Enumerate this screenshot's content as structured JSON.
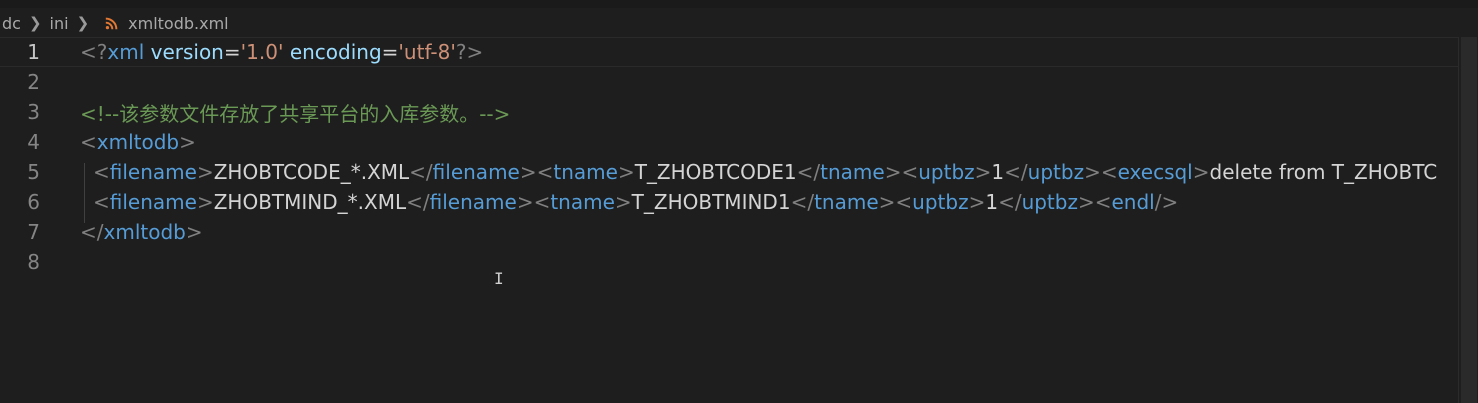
{
  "breadcrumb": {
    "segments": [
      "dc",
      "ini"
    ],
    "file": "xmltodb.xml",
    "file_icon": "rss-feed-icon"
  },
  "lines": {
    "numbers": [
      "1",
      "2",
      "3",
      "4",
      "5",
      "6",
      "7",
      "8"
    ],
    "l1": {
      "open": "<?",
      "name": "xml",
      "attr1": "version",
      "eq1": "=",
      "val1": "'1.0'",
      "attr2": "encoding",
      "eq2": "=",
      "val2": "'utf-8'",
      "close": "?>"
    },
    "l3": {
      "comment": "<!--该参数文件存放了共享平台的入库参数。-->"
    },
    "l4": {
      "lt": "<",
      "tag": "xmltodb",
      "gt": ">"
    },
    "l5": {
      "lt1": "<",
      "t1": "filename",
      "gt1": ">",
      "v1": "ZHOBTCODE_*.XML",
      "ce1": "</",
      "c1": "filename",
      "cg1": ">",
      "lt2": "<",
      "t2": "tname",
      "gt2": ">",
      "v2": "T_ZHOBTCODE1",
      "ce2": "</",
      "c2": "tname",
      "cg2": ">",
      "lt3": "<",
      "t3": "uptbz",
      "gt3": ">",
      "v3": "1",
      "ce3": "</",
      "c3": "uptbz",
      "cg3": ">",
      "lt4": "<",
      "t4": "execsql",
      "gt4": ">",
      "v4": "delete from T_ZHOBTC"
    },
    "l6": {
      "lt1": "<",
      "t1": "filename",
      "gt1": ">",
      "v1": "ZHOBTMIND_*.XML",
      "ce1": "</",
      "c1": "filename",
      "cg1": ">",
      "lt2": "<",
      "t2": "tname",
      "gt2": ">",
      "v2": "T_ZHOBTMIND1",
      "ce2": "</",
      "c2": "tname",
      "cg2": ">",
      "lt3": "<",
      "t3": "uptbz",
      "gt3": ">",
      "v3": "1",
      "ce3": "</",
      "c3": "uptbz",
      "cg3": ">",
      "lt4": "<",
      "t4": "endl",
      "gt4": "/>"
    },
    "l7": {
      "lt": "</",
      "tag": "xmltodb",
      "gt": ">"
    }
  },
  "colors": {
    "background": "#1e1e1e",
    "tag": "#569cd6",
    "attribute": "#9cdcfe",
    "string": "#ce9178",
    "comment": "#6a9955",
    "punctuation": "#808080",
    "text": "#d4d4d4",
    "file_icon": "#e37933"
  }
}
